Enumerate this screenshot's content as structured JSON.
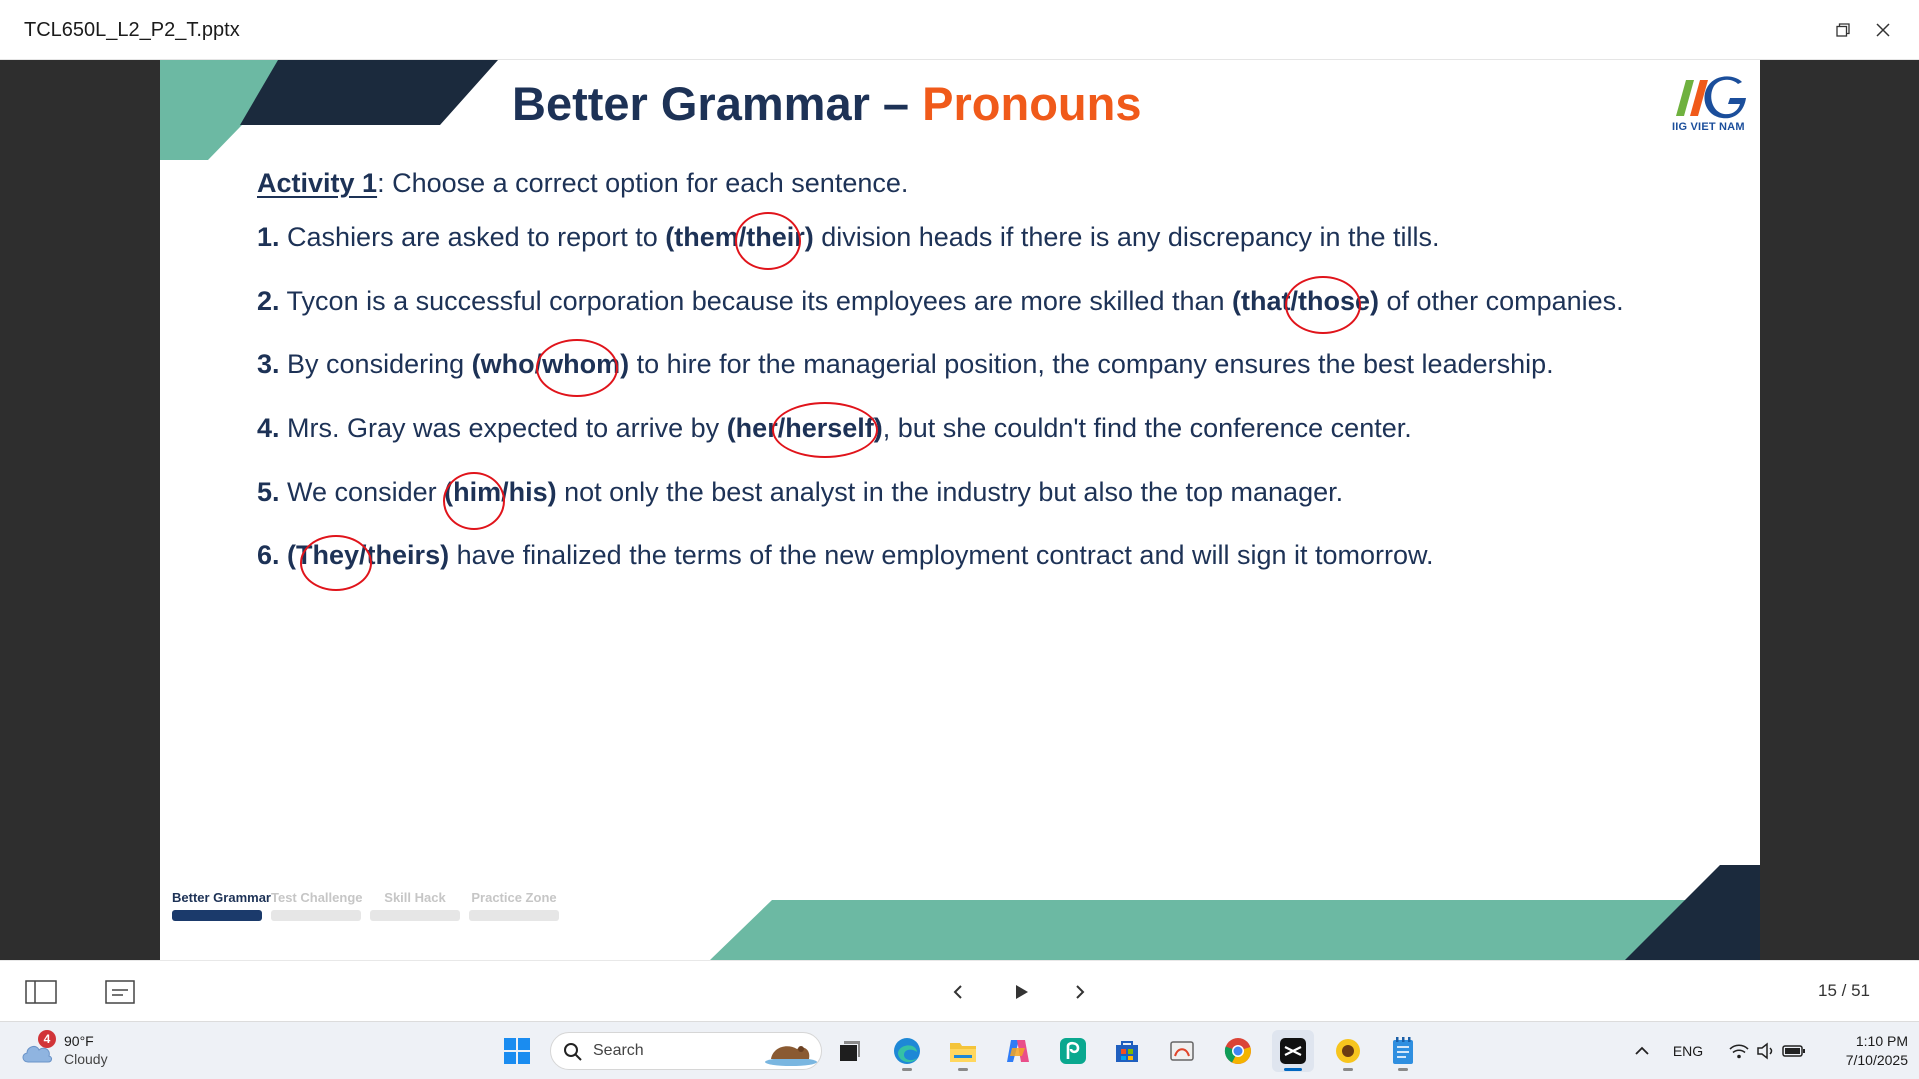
{
  "window": {
    "title": "TCL650L_L2_P2_T.pptx",
    "restore_icon": "restore-icon",
    "close_icon": "close-icon"
  },
  "slide": {
    "title_main": "Better Grammar – ",
    "title_accent": "Pronouns",
    "logo_text": "IIG VIET NAM",
    "activity_label": "Activity 1",
    "activity_text": ": Choose a correct option for each sentence.",
    "questions": [
      {
        "num": "1.",
        "before": " Cashiers are asked to report to ",
        "options": "(them/their)",
        "after": " division heads if there is any discrepancy in the tills.",
        "circled": "their"
      },
      {
        "num": "2.",
        "before": " Tycon is a successful corporation because its employees are more skilled than ",
        "options": "(that/those)",
        "after": " of other companies.",
        "circled": "those"
      },
      {
        "num": "3.",
        "before": " By considering ",
        "options": "(who/whom)",
        "after": " to hire for the managerial position, the company ensures the best leadership.",
        "circled": "whom"
      },
      {
        "num": "4.",
        "before": " Mrs. Gray was expected to arrive by ",
        "options": "(her/herself)",
        "after": ", but she couldn't find the conference center.",
        "circled": "herself"
      },
      {
        "num": "5.",
        "before": " We consider ",
        "options": "(him/his)",
        "after": " not only the best analyst in the industry but also the top manager.",
        "circled": "him"
      },
      {
        "num": "6.",
        "before": " ",
        "options": "(They/theirs)",
        "after": " have finalized the terms of the new employment contract and will sign it tomorrow.",
        "circled": "They"
      }
    ],
    "progress_steps": [
      {
        "label": "Better Grammar",
        "active": true
      },
      {
        "label": "Test Challenge",
        "active": false
      },
      {
        "label": "Skill Hack",
        "active": false
      },
      {
        "label": "Practice Zone",
        "active": false
      }
    ],
    "colors": {
      "navy": "#1d3256",
      "accent": "#f05a1a",
      "teal": "#6cb9a3",
      "dark": "#1b2a3d",
      "answer_circle": "#e0141b"
    }
  },
  "viewer_toolbar": {
    "sidebar_icon": "sidebar-panel-icon",
    "notes_icon": "notes-icon",
    "prev_icon": "chevron-left-icon",
    "play_icon": "play-icon",
    "next_icon": "chevron-right-icon",
    "page_current": "15",
    "page_sep": " / ",
    "page_total": "51"
  },
  "taskbar": {
    "weather_badge": "4",
    "weather_temp": "90°F",
    "weather_condition": "Cloudy",
    "search_label": "Search",
    "apps": [
      "windows-start-icon",
      "task-view-icon",
      "edge-icon",
      "file-explorer-icon",
      "copilot-icon",
      "picsart-icon",
      "store-icon",
      "snipping-icon",
      "chrome-icon",
      "capcut-icon",
      "sunflower-icon",
      "notepad-icon"
    ],
    "language": "ENG",
    "time": "1:10 PM",
    "date": "7/10/2025"
  }
}
